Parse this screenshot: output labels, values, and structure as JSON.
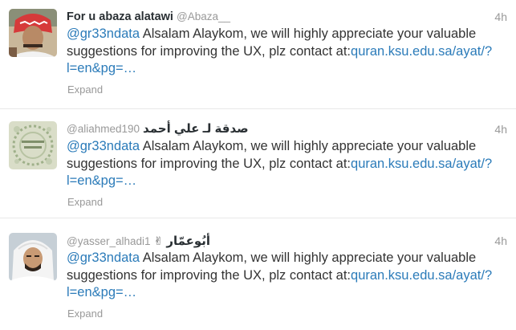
{
  "tweets": [
    {
      "fullname": "For u abaza alatawi",
      "screenname": "@Abaza__",
      "time": "4h",
      "mention": "@gr33ndata",
      "text": " Alsalam Alaykom, we will highly appreciate your valuable suggestions for improving the UX, plz contact at:",
      "link": "quran.ksu.edu.sa/ayat/?l=en&pg=…",
      "expand": "Expand"
    },
    {
      "screenname": "@aliahmed190",
      "arabic_name": "صدقة لـ علي أحمد",
      "time": "4h",
      "mention": "@gr33ndata",
      "text": " Alsalam Alaykom, we will highly appreciate your valuable suggestions for improving the UX, plz contact at:",
      "link": "quran.ksu.edu.sa/ayat/?l=en&pg=…",
      "expand": "Expand"
    },
    {
      "screenname": "@yasser_alhadi1",
      "arabic_name": "أبُوعمّار",
      "arabic_suffix": "✌",
      "time": "4h",
      "mention": "@gr33ndata",
      "text": " Alsalam Alaykom, we will highly appreciate your valuable suggestions for improving the UX, plz contact at:",
      "link": "quran.ksu.edu.sa/ayat/?l=en&pg=…",
      "expand": "Expand"
    }
  ],
  "colors": {
    "link": "#2b7bb9",
    "muted": "#999999",
    "name": "#292f33",
    "body": "#333333"
  }
}
